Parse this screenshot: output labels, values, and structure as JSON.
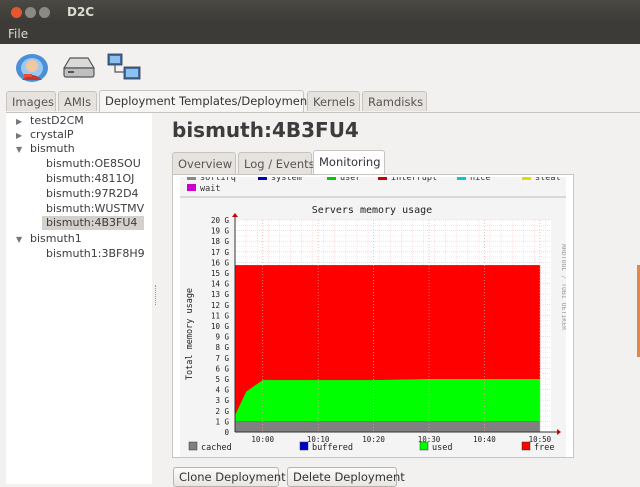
{
  "window": {
    "title": "D2C"
  },
  "menu": {
    "file": "File"
  },
  "toolbar": {
    "icons": [
      "user-cloud-icon",
      "drive-icon",
      "network-computers-icon"
    ]
  },
  "top_tabs": [
    {
      "label": "Images",
      "active": false
    },
    {
      "label": "AMIs",
      "active": false
    },
    {
      "label": "Deployment Templates/Deployments",
      "active": true
    },
    {
      "label": "Kernels",
      "active": false
    },
    {
      "label": "Ramdisks",
      "active": false
    }
  ],
  "tree": [
    {
      "label": "testD2CM",
      "level": 0,
      "expanded": false
    },
    {
      "label": "crystalP",
      "level": 0,
      "expanded": false
    },
    {
      "label": "bismuth",
      "level": 0,
      "expanded": true
    },
    {
      "label": "bismuth:OE8SOU",
      "level": 1
    },
    {
      "label": "bismuth:4811OJ",
      "level": 1
    },
    {
      "label": "bismuth:97R2D4",
      "level": 1
    },
    {
      "label": "bismuth:WUSTMV",
      "level": 1
    },
    {
      "label": "bismuth:4B3FU4",
      "level": 1,
      "selected": true
    },
    {
      "label": "bismuth1",
      "level": 0,
      "expanded": true
    },
    {
      "label": "bismuth1:3BF8H9",
      "level": 1
    }
  ],
  "detail": {
    "title": "bismuth:4B3FU4",
    "tabs": [
      {
        "label": "Overview",
        "active": false
      },
      {
        "label": "Log / Events",
        "active": false
      },
      {
        "label": "Monitoring",
        "active": true
      }
    ],
    "clone_label": "Clone Deployment",
    "delete_label": "Delete Deployment"
  },
  "cpu_legend": {
    "items": [
      {
        "label": "softirq",
        "color": "#888888"
      },
      {
        "label": "system",
        "color": "#0000cc"
      },
      {
        "label": "user",
        "color": "#00cc00"
      },
      {
        "label": "interrupt",
        "color": "#cc0000"
      },
      {
        "label": "nice",
        "color": "#00cccc"
      },
      {
        "label": "steal",
        "color": "#dddd00"
      },
      {
        "label": "wait",
        "color": "#cc00cc"
      }
    ]
  },
  "chart_data": {
    "type": "area",
    "title": "Servers memory usage",
    "ylabel": "Total memory usage",
    "watermark": "RRDTOOL / TOBI OETIKER",
    "ylim": [
      0,
      20
    ],
    "yticks": [
      "0",
      "1 G",
      "2 G",
      "3 G",
      "4 G",
      "5 G",
      "6 G",
      "7 G",
      "8 G",
      "9 G",
      "10 G",
      "11 G",
      "12 G",
      "13 G",
      "14 G",
      "15 G",
      "16 G",
      "17 G",
      "18 G",
      "19 G",
      "20 G"
    ],
    "xticks": [
      "10:00",
      "10:10",
      "10:20",
      "10:30",
      "10:40",
      "10:50"
    ],
    "stacked": true,
    "x": [
      "09:55",
      "09:57",
      "10:00",
      "10:10",
      "10:20",
      "10:30",
      "10:40",
      "10:50"
    ],
    "series": [
      {
        "name": "cached",
        "color": "#808080",
        "values": [
          1.0,
          1.0,
          1.0,
          1.0,
          1.0,
          1.0,
          1.0,
          1.0
        ]
      },
      {
        "name": "buffered",
        "color": "#0000cc",
        "values": [
          0.02,
          0.02,
          0.02,
          0.02,
          0.02,
          0.02,
          0.02,
          0.02
        ]
      },
      {
        "name": "used",
        "color": "#00ff00",
        "values": [
          0.6,
          2.8,
          3.9,
          3.9,
          3.9,
          4.0,
          4.0,
          4.0
        ]
      },
      {
        "name": "free",
        "color": "#ff0000",
        "values": [
          14.1,
          11.9,
          10.8,
          10.8,
          10.8,
          10.7,
          10.7,
          10.7
        ]
      }
    ]
  }
}
